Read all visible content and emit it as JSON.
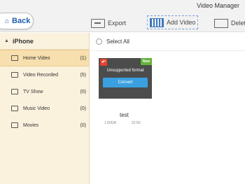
{
  "app": {
    "title": "Video Manager"
  },
  "toolbar": {
    "back_label": "Back",
    "export_label": "Export",
    "add_video_label": "Add Video",
    "delete_label": "Delete"
  },
  "sidebar": {
    "device": "iPhone",
    "items": [
      {
        "label": "Home Video",
        "count": "(1)",
        "icon": "home-video-icon"
      },
      {
        "label": "Video Recorded",
        "count": "(5)",
        "icon": "video-recorded-icon"
      },
      {
        "label": "TV Show",
        "count": "(0)",
        "icon": "tv-icon"
      },
      {
        "label": "Music Video",
        "count": "(0)",
        "icon": "music-video-icon"
      },
      {
        "label": "Movies",
        "count": "(0)",
        "icon": "movies-icon"
      }
    ]
  },
  "main": {
    "select_all": "Select All",
    "video": {
      "badge": "New",
      "status": "Unsupported format",
      "convert_label": "Convert",
      "name": "test",
      "size": "1.80GB",
      "duration": "22:50"
    }
  },
  "colors": {
    "sidebar_bg": "#fbf2de",
    "active_bg": "#f7dfae",
    "accent_blue": "#3aa0e0",
    "badge_green": "#64b33d",
    "warning_red": "#e8402d"
  }
}
